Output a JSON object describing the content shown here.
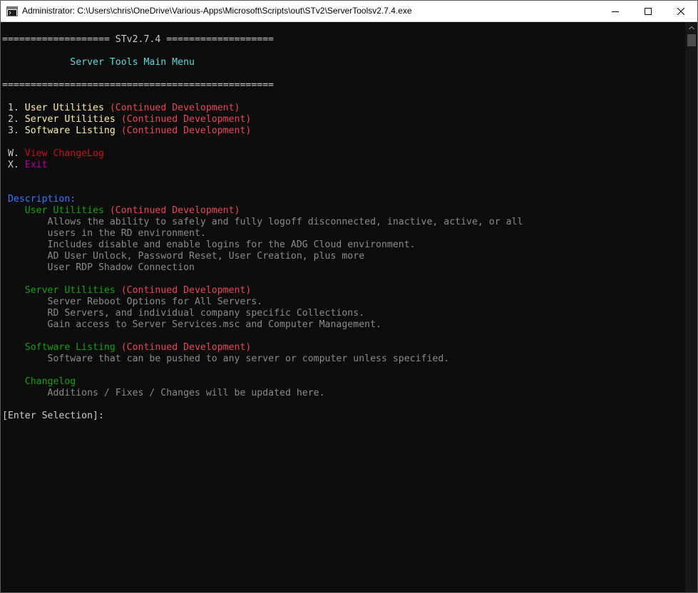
{
  "window": {
    "title": "Administrator: C:\\Users\\chris\\OneDrive\\Various-Apps\\Microsoft\\Scripts\\out\\STv2\\ServerToolsv2.7.4.exe",
    "icon": "console-icon",
    "controls": [
      "minimize-icon",
      "maximize-icon",
      "close-icon"
    ]
  },
  "console": {
    "header_line": "=================== STv2.7.4 ===================",
    "menu_title": "            Server Tools Main Menu",
    "divider": "================================================",
    "menu": [
      {
        "key": " 1. ",
        "label": "User Utilities",
        "note": " (Continued Development)"
      },
      {
        "key": " 2. ",
        "label": "Server Utilities",
        "note": " (Continued Development)"
      },
      {
        "key": " 3. ",
        "label": "Software Listing",
        "note": " (Continued Development)"
      }
    ],
    "extra": [
      {
        "key": " W. ",
        "label": "View ChangeLog"
      },
      {
        "key": " X. ",
        "label": "Exit"
      }
    ],
    "description_heading": " Description:",
    "sections": [
      {
        "title": "    User Utilities",
        "note": " (Continued Development)",
        "lines": [
          "        Allows the ability to safely and fully logoff disconnected, inactive, active, or all",
          "        users in the RD environment.",
          "        Includes disable and enable logins for the ADG Cloud environment.",
          "        AD User Unlock, Password Reset, User Creation, plus more",
          "        User RDP Shadow Connection"
        ]
      },
      {
        "title": "    Server Utilities",
        "note": " (Continued Development)",
        "lines": [
          "        Server Reboot Options for All Servers.",
          "        RD Servers, and individual company specific Collections.",
          "        Gain access to Server Services.msc and Computer Management."
        ]
      },
      {
        "title": "    Software Listing",
        "note": " (Continued Development)",
        "lines": [
          "        Software that can be pushed to any server or computer unless specified."
        ]
      },
      {
        "title": "    Changelog",
        "note": "",
        "lines": [
          "        Additions / Fixes / Changes will be updated here."
        ]
      }
    ],
    "prompt": "[Enter Selection]:"
  },
  "colors": {
    "background": "#0c0c0c",
    "text": "#cccccc",
    "cyan": "#61d6d6",
    "yellow": "#f9f1a5",
    "red": "#e74856",
    "dark_red": "#c50f1f",
    "magenta": "#b4009e",
    "blue": "#3b78ff",
    "green": "#13a10e",
    "dim": "#8a8a8a"
  }
}
